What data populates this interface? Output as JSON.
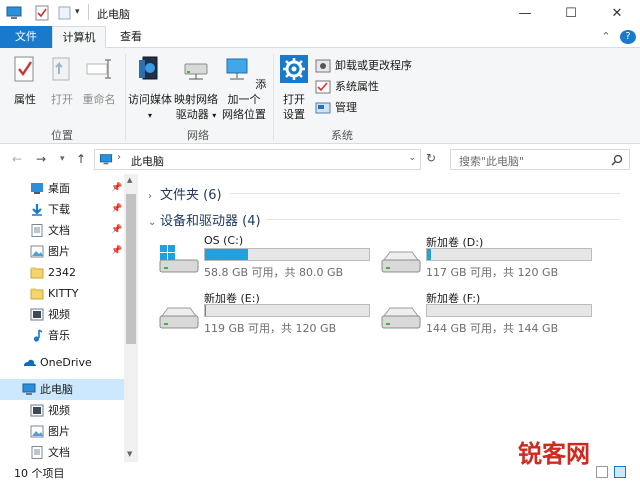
{
  "window": {
    "title": "此电脑",
    "minimize_glyph": "—",
    "maximize_glyph": "☐",
    "close_glyph": "✕"
  },
  "tabs": {
    "file": "文件",
    "computer": "计算机",
    "view": "查看",
    "collapse_glyph": "⌃",
    "help_glyph": "?"
  },
  "ribbon": {
    "location": {
      "label": "位置",
      "properties": "属性",
      "open": "打开",
      "rename": "重命名"
    },
    "network": {
      "label": "网络",
      "access_media": "访问媒体",
      "map_drive_1": "映射网络",
      "map_drive_2": "驱动器",
      "add_location_1": "添加一个",
      "add_location_2": "网络位置"
    },
    "system": {
      "label": "系统",
      "open_settings_1": "打开",
      "open_settings_2": "设置",
      "uninstall": "卸载或更改程序",
      "system_properties": "系统属性",
      "manage": "管理"
    }
  },
  "address": {
    "path": "此电脑",
    "search_placeholder": "搜索\"此电脑\""
  },
  "nav": {
    "items": [
      {
        "label": "桌面",
        "icon": "desktop-icon",
        "pinned": true
      },
      {
        "label": "下载",
        "icon": "download-icon",
        "pinned": true
      },
      {
        "label": "文档",
        "icon": "document-icon",
        "pinned": true
      },
      {
        "label": "图片",
        "icon": "picture-icon",
        "pinned": true
      },
      {
        "label": "2342",
        "icon": "folder-icon",
        "pinned": false
      },
      {
        "label": "KITTY",
        "icon": "folder-icon",
        "pinned": false
      },
      {
        "label": "视频",
        "icon": "video-icon",
        "pinned": false
      },
      {
        "label": "音乐",
        "icon": "music-icon",
        "pinned": false
      },
      {
        "label": "OneDrive",
        "icon": "onedrive-icon",
        "pinned": false
      },
      {
        "label": "此电脑",
        "icon": "this-pc-icon",
        "pinned": false,
        "selected": true
      },
      {
        "label": "视频",
        "icon": "video-icon",
        "pinned": false
      },
      {
        "label": "图片",
        "icon": "picture-icon",
        "pinned": false
      },
      {
        "label": "文档",
        "icon": "document-icon",
        "pinned": false
      }
    ]
  },
  "content": {
    "folders_header": "文件夹 (6)",
    "drives_header": "设备和驱动器 (4)",
    "drives": [
      {
        "name": "OS (C:)",
        "info": "58.8 GB 可用，共 80.0 GB",
        "used_fraction": 0.265,
        "icon": "windows-drive-icon"
      },
      {
        "name": "新加卷 (D:)",
        "info": "117 GB 可用，共 120 GB",
        "used_fraction": 0.025,
        "icon": "hard-drive-icon"
      },
      {
        "name": "新加卷 (E:)",
        "info": "119 GB 可用，共 120 GB",
        "used_fraction": 0.008,
        "icon": "hard-drive-icon"
      },
      {
        "name": "新加卷 (F:)",
        "info": "144 GB 可用，共 144 GB",
        "used_fraction": 0.0,
        "icon": "hard-drive-icon"
      }
    ]
  },
  "status": {
    "item_count": "10 个项目"
  },
  "watermark": {
    "text": "锐客网"
  },
  "colors": {
    "accent": "#1979ca",
    "drive_fill": "#26a0da",
    "selected_bg": "#cce8ff"
  }
}
